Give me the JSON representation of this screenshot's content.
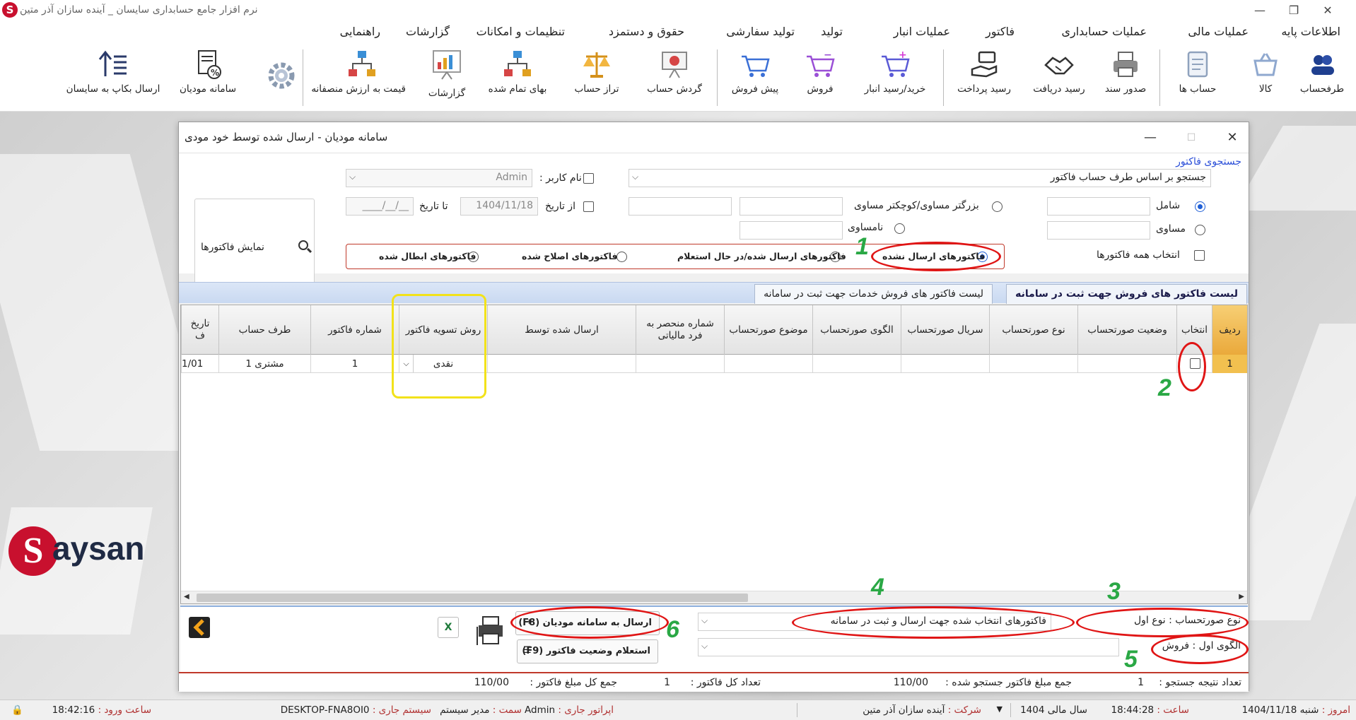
{
  "app": {
    "title": "نرم افزار جامع حسابداری سایسان _ آینده سازان آذر متین",
    "logo_letter": "S",
    "brand_text": "aysan"
  },
  "menu": [
    "اطلاعات پایه",
    "عملیات مالی",
    "عملیات حسابداری",
    "فاکتور",
    "عملیات انبار",
    "تولید",
    "تولید سفارشی",
    "حقوق و دستمزد",
    "تنظیمات و امکانات",
    "گزارشات",
    "راهنمایی"
  ],
  "toolbar": [
    {
      "label": "طرفحساب",
      "icon": "people-icon",
      "color": "#1f3f8f"
    },
    {
      "label": "کالا",
      "icon": "basket-icon",
      "color": "#b9c9e6"
    },
    {
      "label": "حساب ها",
      "icon": "ledger-icon",
      "color": "#8fa2bd"
    },
    {
      "label": "صدور سند",
      "icon": "printer-icon",
      "color": "#7f7f7f"
    },
    {
      "label": "رسید دریافت",
      "icon": "handshake-icon",
      "color": "#3a3a3a"
    },
    {
      "label": "رسید پرداخت",
      "icon": "hand-money-icon",
      "color": "#3a3a3a"
    },
    {
      "label": "خرید/رسید انبار",
      "icon": "cart-add-icon",
      "color": "#9a4fd6"
    },
    {
      "label": "فروش",
      "icon": "cart-icon",
      "color": "#9a4fd6"
    },
    {
      "label": "پیش فروش",
      "icon": "cart-pre-icon",
      "color": "#3a6fd6"
    },
    {
      "label": "گردش حساب",
      "icon": "presentation-icon",
      "color": "#d64545"
    },
    {
      "label": "تراز حساب",
      "icon": "scale-icon",
      "color": "#e0a020"
    },
    {
      "label": "بهای تمام شده",
      "icon": "org-chart-icon",
      "color": "#3a8fd6"
    },
    {
      "label": "گزارشات",
      "icon": "report-chart-icon",
      "color": "#d67a20"
    },
    {
      "label": "قیمت به ارزش منصفانه",
      "icon": "org-price-icon",
      "color": "#3a8fd6"
    },
    {
      "label": "",
      "icon": "gear-icon",
      "color": "#8a9ab0"
    },
    {
      "label": "سامانه مودیان",
      "icon": "tax-doc-icon",
      "color": "#333333"
    },
    {
      "label": "ارسال بکاپ به سایسان",
      "icon": "upload-list-icon",
      "color": "#2a3a6a"
    }
  ],
  "dialog": {
    "title": "سامانه مودیان    -    ارسال شده توسط خود مودی",
    "search_legend": "جستجوی فاکتور",
    "search_by_account": "جستجو بر اساس طرف حساب فاکتور",
    "username_label": "نام کاربر :",
    "username_value": "Admin",
    "from_date_label": "از تاریخ",
    "from_date_value": "1404/11/18",
    "to_date_label": "تا تاریخ",
    "to_date_value": "__/__/____",
    "opt_contains": "شامل",
    "opt_equal": "مساوی",
    "opt_ge_le": "بزرگتر مساوی/کوچکتر مساوی",
    "opt_not_equal": "نامساوی",
    "select_all": "انتخاب همه فاکتورها",
    "show_button": "نمایش فاکتورها",
    "filters": [
      "فاکتورهای ارسال نشده",
      "فاکتورهای ارسال شده/در حال استعلام",
      "فاکتورهای اصلاح شده",
      "فاکتورهای ابطال شده"
    ],
    "tabs": [
      "لیست فاکتور های فروش جهت ثبت در سامانه",
      "لیست فاکتور های فروش خدمات جهت ثبت در سامانه"
    ],
    "columns": [
      "ردیف",
      "انتخاب",
      "وضعیت صورتحساب",
      "نوع صورتحساب",
      "سریال صورتحساب",
      "الگوی صورتحساب",
      "موضوع صورتحساب",
      "شماره منحصر به فرد مالیاتی",
      "ارسال شده توسط",
      "روش تسویه فاکتور",
      "شماره فاکتور",
      "طرف حساب",
      "تاریخ ف"
    ],
    "rows": [
      {
        "row": "1",
        "status": "",
        "type": "",
        "serial": "",
        "pattern": "",
        "subject": "",
        "tax_id": "",
        "sent_by": "",
        "settlement": "نقدی",
        "invoice_no": "1",
        "party": "مشتری 1",
        "date": "1/01"
      }
    ],
    "invoice_type": "نوع صورتحساب : نوع اول",
    "invoice_pattern": "الگوی اول : فروش",
    "selected_action": "فاکتورهای انتخاب شده جهت ارسال و ثبت در سامانه",
    "send_button": "ارسال به سامانه مودیان (F8)",
    "inquiry_button": "استعلام وضعیت فاکتور (F9)",
    "result_count_label": "تعداد نتیجه جستجو :",
    "result_count": "1",
    "search_sum_label": "جمع مبلغ فاکتور جستجو شده :",
    "search_sum": "110/00",
    "total_count_label": "تعداد کل فاکتور :",
    "total_count": "1",
    "total_sum_label": "جمع کل مبلغ فاکتور :",
    "total_sum": "110/00"
  },
  "statusbar": {
    "today_label": "امروز :",
    "today": "شنبه  1404/11/18",
    "time_label": "ساعت :",
    "time": "18:44:28",
    "fiscal_label": "سال مالی",
    "fiscal": "1404",
    "company_label": "شرکت :",
    "company": "آینده سازان آذر متین",
    "operator_label": "اپراتور جاری :",
    "operator": "Admin",
    "role_label": "سمت :",
    "role": "مدیر سیستم",
    "system_label": "سیستم جاری :",
    "system": "DESKTOP-FNA8OI0",
    "login_label": "ساعت ورود :",
    "login": "18:42:16"
  },
  "annotations": [
    "1",
    "2",
    "3",
    "4",
    "5",
    "6"
  ]
}
